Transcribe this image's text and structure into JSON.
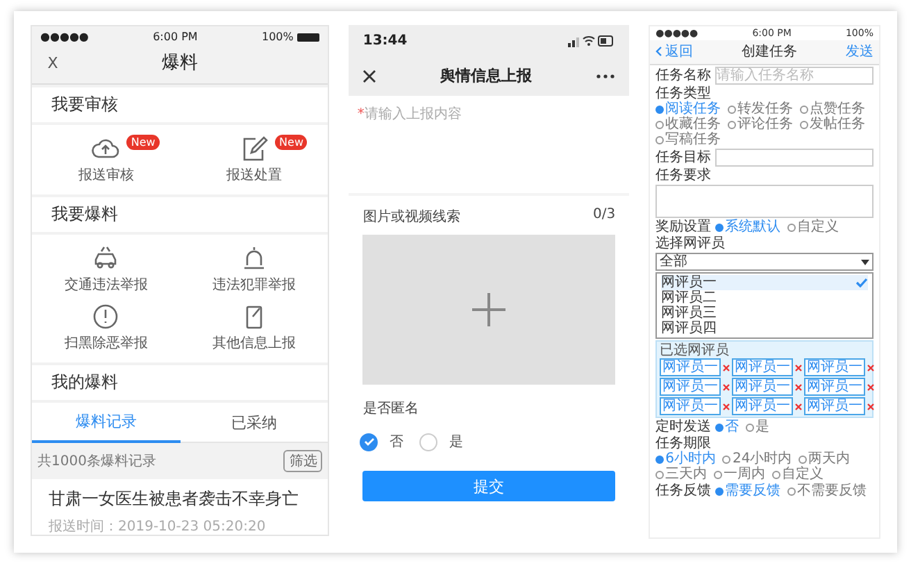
{
  "screens": [
    {
      "status": {
        "carrier": "●●●●●",
        "time": "6:00 PM",
        "battery": "100%"
      },
      "nav": {
        "close": "X",
        "title": "爆料"
      },
      "sections": [
        {
          "title": "我要审核",
          "items": [
            {
              "label": "报送审核",
              "badge": "New"
            },
            {
              "label": "报送处置",
              "badge": "New"
            }
          ]
        },
        {
          "title": "我要爆料",
          "items": [
            {
              "label": "交通违法举报"
            },
            {
              "label": "违法犯罪举报"
            },
            {
              "label": "扫黑除恶举报"
            },
            {
              "label": "其他信息上报"
            }
          ]
        },
        {
          "title": "我的爆料"
        }
      ],
      "tabs": [
        {
          "label": "爆料记录",
          "selected": true
        },
        {
          "label": "已采纳",
          "selected": false
        }
      ],
      "count": "共1000条爆料记录",
      "filter_button": "筛选",
      "record": {
        "title": "甘肃一女医生被患者袭击不幸身亡",
        "time": "报送时间：2019-10-23 05:20:20"
      }
    },
    {
      "status": {
        "time": "13:44"
      },
      "nav": {
        "title": "舆情信息上报"
      },
      "content_field": {
        "required_mark": "*",
        "placeholder": "请输入上报内容"
      },
      "media": {
        "label": "图片或视频线索",
        "count": "0/3"
      },
      "anonymous": {
        "label": "是否匿名",
        "options": [
          {
            "label": "否",
            "selected": true
          },
          {
            "label": "是",
            "selected": false
          }
        ]
      },
      "submit_button": "提交"
    },
    {
      "status": {
        "carrier": "●●●●●",
        "time": "6:00 PM",
        "battery": "100%"
      },
      "nav": {
        "back": "返回",
        "title": "创建任务",
        "action": "发送"
      },
      "fields": [
        {
          "kind": "input",
          "label": "任务名称",
          "placeholder": "请输入任务名称"
        },
        {
          "kind": "radio",
          "label": "任务类型",
          "options": [
            {
              "label": "阅读任务",
              "selected": true
            },
            {
              "label": "转发任务",
              "selected": false
            },
            {
              "label": "点赞任务",
              "selected": false
            },
            {
              "label": "收藏任务",
              "selected": false
            },
            {
              "label": "评论任务",
              "selected": false
            },
            {
              "label": "发帖任务",
              "selected": false
            },
            {
              "label": "写稿任务",
              "selected": false
            }
          ]
        },
        {
          "kind": "input",
          "label": "任务目标"
        },
        {
          "kind": "textarea",
          "label": "任务要求"
        },
        {
          "kind": "radio-inline",
          "label": "奖励设置",
          "options": [
            {
              "label": "系统默认",
              "selected": true
            },
            {
              "label": "自定义",
              "selected": false
            }
          ]
        },
        {
          "kind": "select",
          "label": "选择网评员",
          "value": "全部",
          "list": [
            {
              "label": "网评员一",
              "selected": true
            },
            {
              "label": "网评员二",
              "selected": false
            },
            {
              "label": "网评员三",
              "selected": false
            },
            {
              "label": "网评员四",
              "selected": false
            }
          ]
        },
        {
          "kind": "chips",
          "label": "已选网评员",
          "chips": [
            "网评员一",
            "网评员一",
            "网评员一",
            "网评员一",
            "网评员一",
            "网评员一",
            "网评员一",
            "网评员一",
            "网评员一"
          ]
        },
        {
          "kind": "radio-inline",
          "label": "定时发送",
          "options": [
            {
              "label": "否",
              "selected": true
            },
            {
              "label": "是",
              "selected": false
            }
          ]
        },
        {
          "kind": "radio",
          "label": "任务期限",
          "options": [
            {
              "label": "6小时内",
              "selected": true
            },
            {
              "label": "24小时内",
              "selected": false
            },
            {
              "label": "两天内",
              "selected": false
            },
            {
              "label": "三天内",
              "selected": false
            },
            {
              "label": "一周内",
              "selected": false
            },
            {
              "label": "自定义",
              "selected": false
            }
          ]
        },
        {
          "kind": "radio-inline",
          "label": "任务反馈",
          "options": [
            {
              "label": "需要反馈",
              "selected": true
            },
            {
              "label": "不需要反馈",
              "selected": false
            }
          ]
        }
      ]
    }
  ]
}
